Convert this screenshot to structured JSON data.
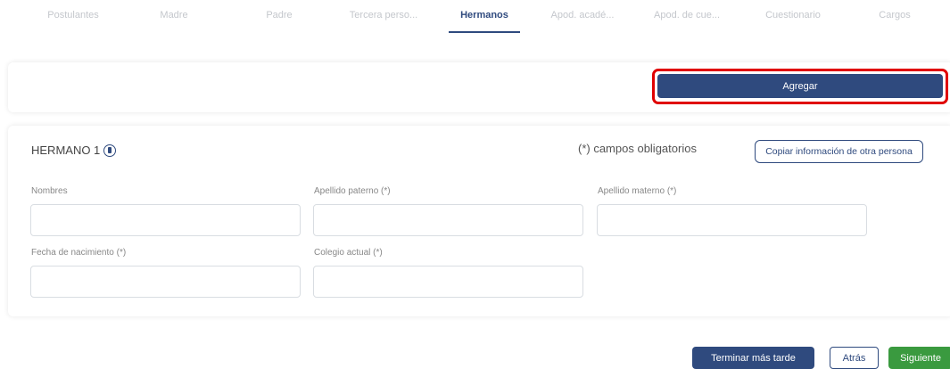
{
  "tabs": [
    {
      "label": "Postulantes"
    },
    {
      "label": "Madre"
    },
    {
      "label": "Padre"
    },
    {
      "label": "Tercera perso..."
    },
    {
      "label": "Hermanos"
    },
    {
      "label": "Apod. acadé..."
    },
    {
      "label": "Apod. de cue..."
    },
    {
      "label": "Cuestionario"
    },
    {
      "label": "Cargos"
    }
  ],
  "active_tab": "Hermanos",
  "top_bar": {
    "add_label": "Agregar"
  },
  "form": {
    "title": "HERMANO 1",
    "info_icon": "info-icon",
    "required_note": "(*) campos obligatorios",
    "copy_label": "Copiar información de otra persona",
    "fields": {
      "nombres": {
        "label": "Nombres",
        "value": ""
      },
      "apellido_paterno": {
        "label": "Apellido paterno (*)",
        "value": ""
      },
      "apellido_materno": {
        "label": "Apellido materno (*)",
        "value": ""
      },
      "fecha_nacimiento": {
        "label": "Fecha de nacimiento (*)",
        "value": ""
      },
      "colegio_actual": {
        "label": "Colegio actual (*)",
        "value": ""
      }
    }
  },
  "footer": {
    "later_label": "Terminar más tarde",
    "back_label": "Atrás",
    "next_label": "Siguiente"
  },
  "colors": {
    "primary": "#2f4a7e",
    "success": "#3a9a3f",
    "highlight": "#e00000"
  }
}
